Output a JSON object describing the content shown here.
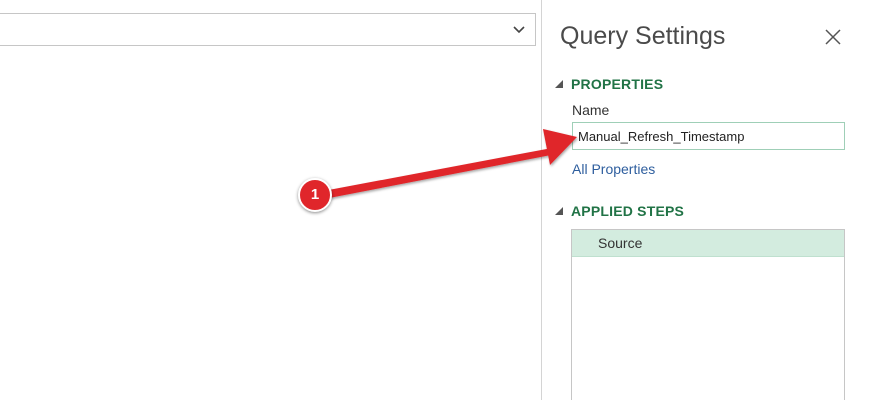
{
  "query_settings": {
    "title": "Query Settings",
    "close_icon": "close-icon",
    "properties": {
      "header": "PROPERTIES",
      "name_label": "Name",
      "name_value": "Manual_Refresh_Timestamp",
      "all_properties_link": "All Properties"
    },
    "applied_steps": {
      "header": "APPLIED STEPS",
      "steps": [
        {
          "label": "Source",
          "selected": true
        }
      ]
    }
  },
  "formula_bar": {
    "dropdown_icon": "chevron-down-icon"
  },
  "annotation": {
    "badge_number": "1",
    "color": "#e0262b"
  },
  "colors": {
    "section_header": "#217346",
    "link": "#2e5e9e",
    "selected_step_bg": "#d3ecdf"
  }
}
